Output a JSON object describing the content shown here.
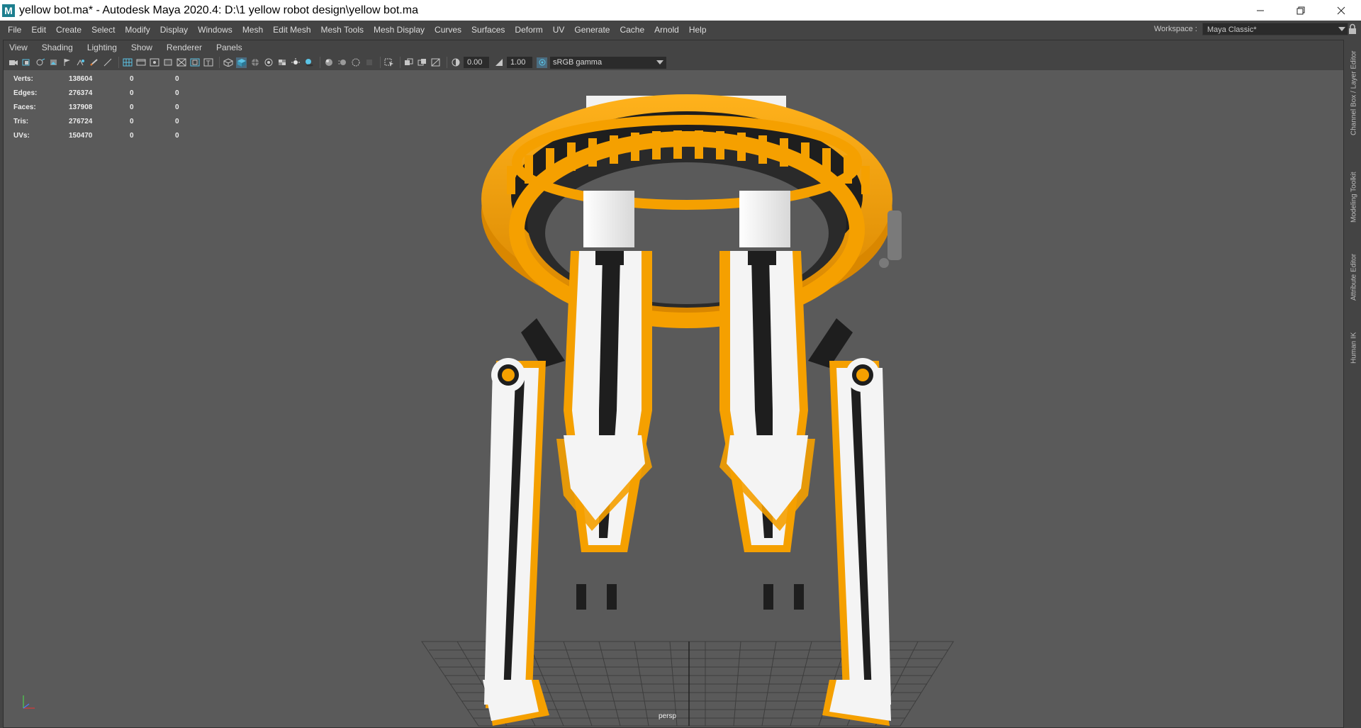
{
  "window": {
    "title": "yellow bot.ma* - Autodesk Maya 2020.4: D:\\1 yellow robot design\\yellow bot.ma",
    "logo_letter": "M",
    "controls": [
      "minimize-icon",
      "restore-icon",
      "close-icon"
    ]
  },
  "menubar": {
    "items": [
      "File",
      "Edit",
      "Create",
      "Select",
      "Modify",
      "Display",
      "Windows",
      "Mesh",
      "Edit Mesh",
      "Mesh Tools",
      "Mesh Display",
      "Curves",
      "Surfaces",
      "Deform",
      "UV",
      "Generate",
      "Cache",
      "Arnold",
      "Help"
    ],
    "workspace_label": "Workspace :",
    "workspace_value": "Maya Classic*"
  },
  "panel": {
    "menu": [
      "View",
      "Shading",
      "Lighting",
      "Show",
      "Renderer",
      "Panels"
    ],
    "exposure": "0.00",
    "gamma": "1.00",
    "colorspace": "sRGB gamma"
  },
  "hud": {
    "rows": [
      {
        "label": "Verts:",
        "value": "138604",
        "a": "0",
        "b": "0"
      },
      {
        "label": "Edges:",
        "value": "276374",
        "a": "0",
        "b": "0"
      },
      {
        "label": "Faces:",
        "value": "137908",
        "a": "0",
        "b": "0"
      },
      {
        "label": "Tris:",
        "value": "276724",
        "a": "0",
        "b": "0"
      },
      {
        "label": "UVs:",
        "value": "150470",
        "a": "0",
        "b": "0"
      }
    ]
  },
  "viewport": {
    "camera": "persp",
    "colors": {
      "background": "#5a5a5a",
      "yellow": "#f5a000",
      "white": "#f4f4f4",
      "dark": "#1e1e1e"
    }
  },
  "side_tabs": [
    "Channel Box / Layer Editor",
    "Modeling Toolkit",
    "Attribute Editor",
    "Human IK"
  ]
}
